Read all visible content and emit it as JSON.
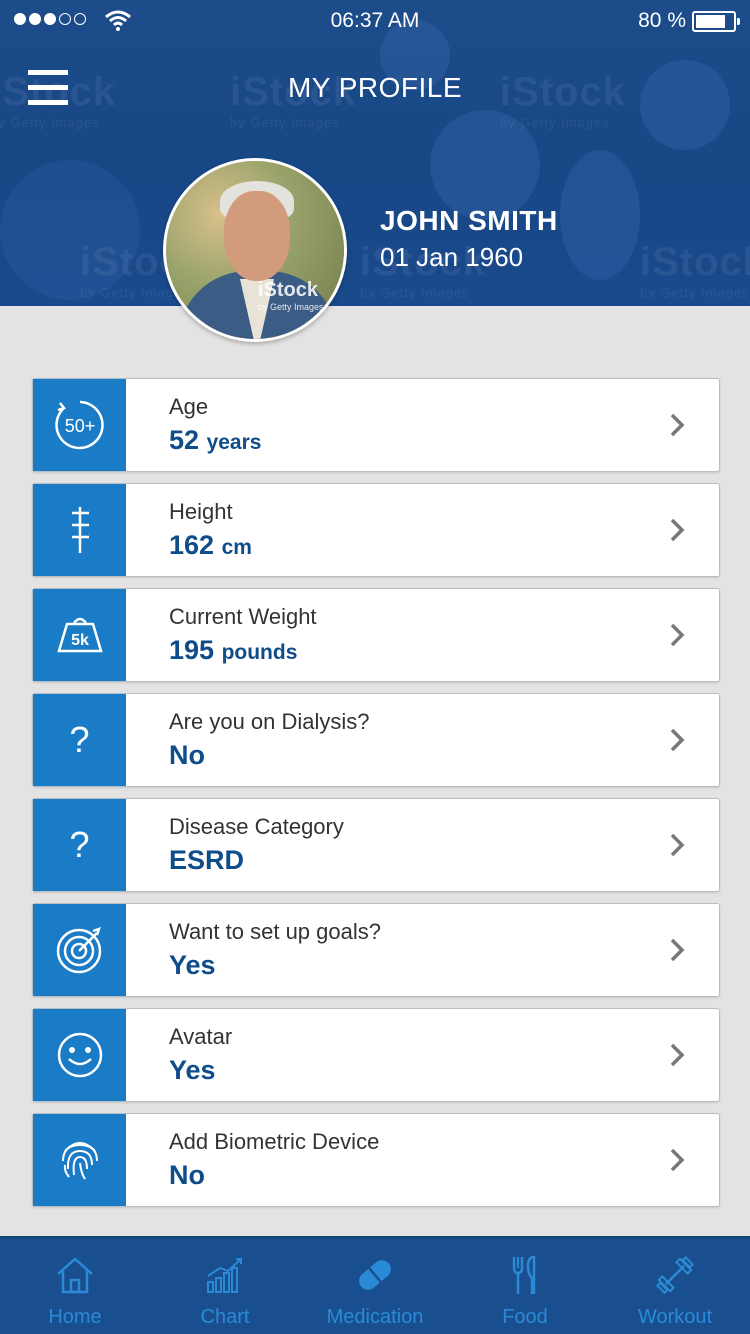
{
  "status": {
    "time": "06:37 AM",
    "battery": "80 %",
    "signal_icon": "signal-dots-icon",
    "wifi_icon": "wifi-icon",
    "battery_icon": "battery-icon"
  },
  "header": {
    "title": "MY PROFILE",
    "menu_icon": "hamburger-menu-icon",
    "watermarks": [
      "iStock",
      "by Getty Images"
    ]
  },
  "profile": {
    "name": "JOHN SMITH",
    "dob": "01 Jan 1960",
    "photo_watermark": "iStock",
    "photo_watermark_sub": "by Getty Images"
  },
  "items": [
    {
      "label": "Age",
      "value": "52",
      "unit": "years",
      "icon": "age-50-plus-icon",
      "icon_text": "50+"
    },
    {
      "label": "Height",
      "value": "162",
      "unit": "cm",
      "icon": "ruler-icon"
    },
    {
      "label": "Current Weight",
      "value": "195",
      "unit": "pounds",
      "icon": "weight-5k-icon",
      "icon_text": "5k"
    },
    {
      "label": "Are you on Dialysis?",
      "value": "No",
      "unit": "",
      "icon": "question-icon",
      "icon_text": "?"
    },
    {
      "label": "Disease Category",
      "value": "ESRD",
      "unit": "",
      "icon": "question-icon",
      "icon_text": "?"
    },
    {
      "label": "Want to set up goals?",
      "value": "Yes",
      "unit": "",
      "icon": "target-icon"
    },
    {
      "label": "Avatar",
      "value": "Yes",
      "unit": "",
      "icon": "smiley-icon"
    },
    {
      "label": "Add Biometric Device",
      "value": "No",
      "unit": "",
      "icon": "fingerprint-icon"
    }
  ],
  "tabs": [
    {
      "label": "Home",
      "icon": "home-icon"
    },
    {
      "label": "Chart",
      "icon": "chart-icon"
    },
    {
      "label": "Medication",
      "icon": "pill-icon"
    },
    {
      "label": "Food",
      "icon": "fork-knife-icon"
    },
    {
      "label": "Workout",
      "icon": "dumbbell-icon"
    }
  ],
  "colors": {
    "header": "#1d4c8a",
    "accent": "#1a7cc6",
    "value_text": "#0f4c8a",
    "tabbar": "#1a4f8f",
    "tab_text": "#2a8ad6"
  }
}
